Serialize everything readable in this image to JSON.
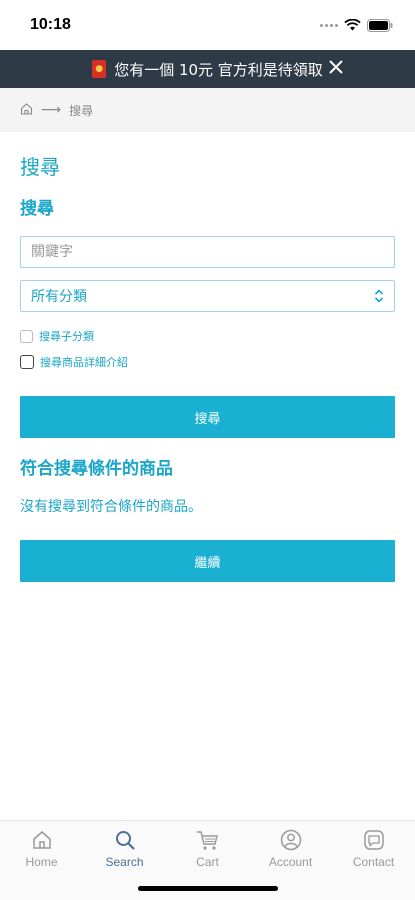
{
  "status_bar": {
    "time": "10:18"
  },
  "promo": {
    "text": "您有一個 10元 官方利是待領取",
    "icon": "red-envelope-icon"
  },
  "breadcrumb": {
    "current": "搜尋"
  },
  "page": {
    "title": "搜尋"
  },
  "search_form": {
    "section_title": "搜尋",
    "keyword_placeholder": "關鍵字",
    "keyword_value": "",
    "category_selected": "所有分類",
    "checkbox_subcategories": "搜尋子分類",
    "checkbox_description": "搜尋商品詳細介紹",
    "search_button": "搜尋"
  },
  "results": {
    "title": "符合搜尋條件的商品",
    "empty_message": "沒有搜尋到符合條件的商品。",
    "continue_button": "繼續"
  },
  "tabs": [
    {
      "label": "Home",
      "icon": "home-icon"
    },
    {
      "label": "Search",
      "icon": "search-icon"
    },
    {
      "label": "Cart",
      "icon": "cart-icon"
    },
    {
      "label": "Account",
      "icon": "account-icon"
    },
    {
      "label": "Contact",
      "icon": "contact-icon"
    }
  ],
  "colors": {
    "accent": "#1aa6c9",
    "button": "#1ab0d2",
    "banner": "#2e3a45",
    "active_tab": "#4a6f9a"
  }
}
